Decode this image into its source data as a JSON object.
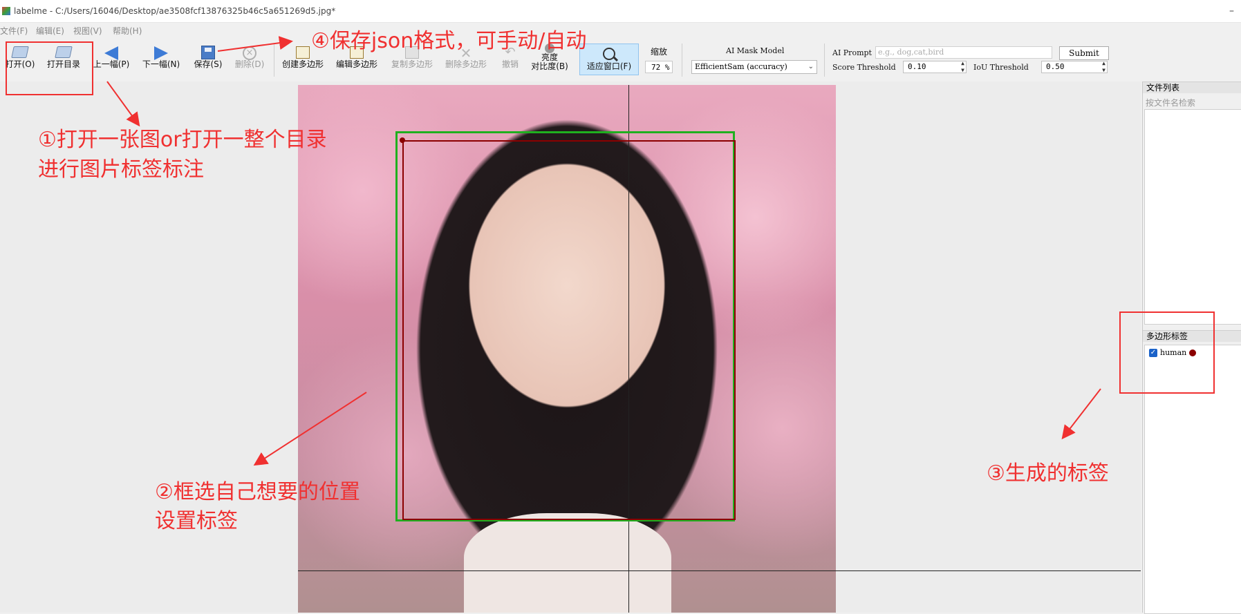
{
  "window": {
    "title": "labelme - C:/Users/16046/Desktop/ae3508fcf13876325b46c5a651269d5.jpg*",
    "minimize": "–"
  },
  "menu": [
    "文件(F)",
    "编辑(E)",
    "视图(V)",
    "帮助(H)"
  ],
  "toolbar": {
    "open": "打开(O)",
    "open_dir": "打开目录",
    "prev": "上一幅(P)",
    "next": "下一幅(N)",
    "save": "保存(S)",
    "delete": "删除(D)",
    "create_polygon": "创建多边形",
    "edit_polygon": "编辑多边形",
    "copy_polygon": "复制多边形",
    "delete_polygon": "删除多边形",
    "undo": "撤销",
    "brightness_1": "亮度",
    "brightness_2": "对比度(B)",
    "fit_window": "适应窗口(F)",
    "zoom_label": "缩放",
    "zoom_value": "72 %",
    "ai_mask_label": "AI Mask Model",
    "ai_mask_value": "EfficientSam (accuracy)",
    "ai_prompt_label": "AI Prompt",
    "ai_prompt_placeholder": "e.g., dog,cat,bird",
    "submit": "Submit",
    "score_label": "Score Threshold",
    "score_value": "0.10",
    "iou_label": "IoU Threshold",
    "iou_value": "0.50"
  },
  "right_panel": {
    "file_list_title": "文件列表",
    "file_search_placeholder": "按文件名检索",
    "labels_title": "多边形标签",
    "labels": [
      {
        "name": "human",
        "checked": true,
        "color": "#8b0000"
      }
    ]
  },
  "annotations": {
    "step1_line1": "①打开一张图or打开一整个目录",
    "step1_line2": "进行图片标签标注",
    "step2_line1": "②框选自己想要的位置",
    "step2_line2": "设置标签",
    "step3": "③生成的标签",
    "step4": "④保存json格式，可手动/自动"
  },
  "colors": {
    "annotation_red": "#f03030",
    "shape_green": "#1fb01f",
    "shape_red": "#8b0000",
    "fit_window_active": "#cde8fb"
  }
}
